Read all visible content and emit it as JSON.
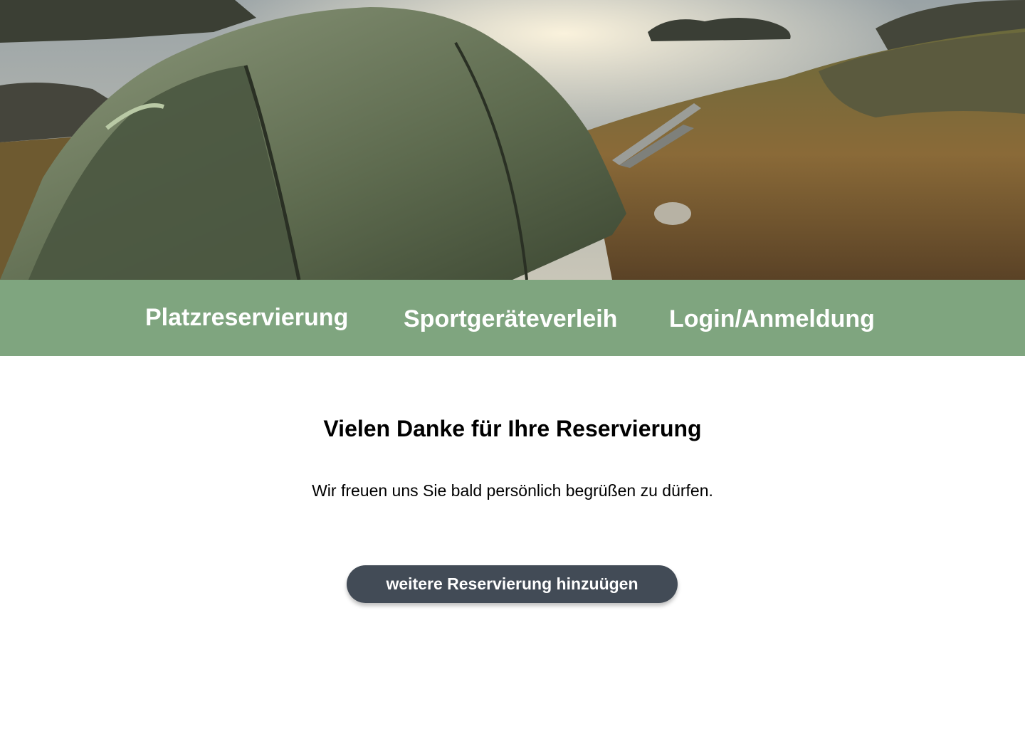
{
  "nav": {
    "items": [
      {
        "label": "Platzreservierung"
      },
      {
        "label": "Sportgeräteverleih"
      },
      {
        "label": "Login/Anmeldung"
      }
    ]
  },
  "main": {
    "heading": "Vielen Danke für Ihre Reservierung",
    "subtext": "Wir freuen uns Sie bald persönlich begrüßen zu dürfen.",
    "button_label": "weitere Reservierung hinzuügen"
  },
  "colors": {
    "nav_background": "#7fa57f",
    "button_background": "#424b56",
    "text": "#000000"
  }
}
